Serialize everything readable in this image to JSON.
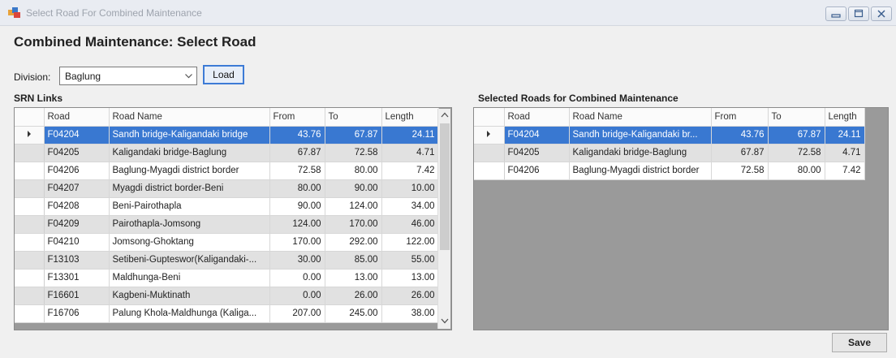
{
  "window": {
    "title": "Select Road For Combined Maintenance",
    "controls": [
      "minimize-icon",
      "maximize-icon",
      "close-icon"
    ]
  },
  "form": {
    "heading": "Combined Maintenance: Select Road",
    "division_label": "Division:",
    "division_value": "Baglung",
    "load_label": "Load",
    "save_label": "Save"
  },
  "srn": {
    "title": "SRN Links",
    "columns": [
      "Road",
      "Road Name",
      "From",
      "To",
      "Length"
    ],
    "rows": [
      [
        "F04204",
        "Sandh bridge-Kaligandaki bridge",
        "43.76",
        "67.87",
        "24.11"
      ],
      [
        "F04205",
        "Kaligandaki bridge-Baglung",
        "67.87",
        "72.58",
        "4.71"
      ],
      [
        "F04206",
        "Baglung-Myagdi district border",
        "72.58",
        "80.00",
        "7.42"
      ],
      [
        "F04207",
        "Myagdi district border-Beni",
        "80.00",
        "90.00",
        "10.00"
      ],
      [
        "F04208",
        "Beni-Pairothapla",
        "90.00",
        "124.00",
        "34.00"
      ],
      [
        "F04209",
        "Pairothapla-Jomsong",
        "124.00",
        "170.00",
        "46.00"
      ],
      [
        "F04210",
        "Jomsong-Ghoktang",
        "170.00",
        "292.00",
        "122.00"
      ],
      [
        "F13103",
        "Setibeni-Gupteswor(Kaligandaki-...",
        "30.00",
        "85.00",
        "55.00"
      ],
      [
        "F13301",
        "Maldhunga-Beni",
        "0.00",
        "13.00",
        "13.00"
      ],
      [
        "F16601",
        "Kagbeni-Muktinath",
        "0.00",
        "26.00",
        "26.00"
      ],
      [
        "F16706",
        "Palung Khola-Maldhunga (Kaliga...",
        "207.00",
        "245.00",
        "38.00"
      ]
    ],
    "selected_index": 0
  },
  "selected_roads": {
    "title": "Selected Roads for Combined Maintenance",
    "columns": [
      "Road",
      "Road Name",
      "From",
      "To",
      "Length"
    ],
    "rows": [
      [
        "F04204",
        "Sandh bridge-Kaligandaki br...",
        "43.76",
        "67.87",
        "24.11"
      ],
      [
        "F04205",
        "Kaligandaki bridge-Baglung",
        "67.87",
        "72.58",
        "4.71"
      ],
      [
        "F04206",
        "Baglung-Myagdi district border",
        "72.58",
        "80.00",
        "7.42"
      ]
    ],
    "selected_index": 0
  },
  "colors": {
    "selection": "#3978d1",
    "alt_row": "#e1e1e1",
    "grid_background": "#9a9a9a"
  }
}
